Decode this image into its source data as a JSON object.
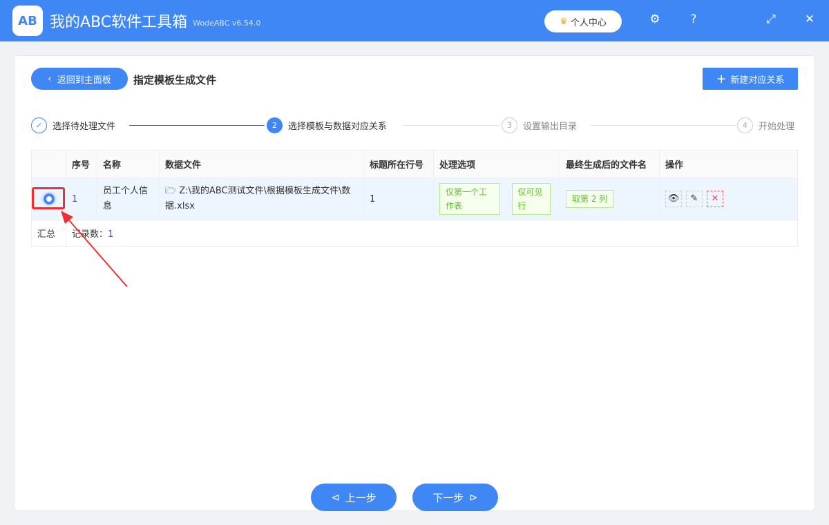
{
  "app": {
    "logo": "AB",
    "title": "我的ABC软件工具箱",
    "version": "WodeABC v6.54.0",
    "user_center": "个人中心"
  },
  "header": {
    "back": "返回到主面板",
    "title": "指定模板生成文件",
    "new_relation": "新建对应关系"
  },
  "steps": [
    {
      "num": "✓",
      "label": "选择待处理文件"
    },
    {
      "num": "2",
      "label": "选择模板与数据对应关系"
    },
    {
      "num": "3",
      "label": "设置输出目录"
    },
    {
      "num": "4",
      "label": "开始处理"
    }
  ],
  "table": {
    "headers": [
      "",
      "序号",
      "名称",
      "数据文件",
      "标题所在行号",
      "处理选项",
      "最终生成后的文件名",
      "操作"
    ],
    "row": {
      "index": "1",
      "name": "员工个人信息",
      "file": "Z:\\我的ABC测试文件\\根据模板生成文件\\数据.xlsx",
      "title_row": "1",
      "options": [
        "仅第一个工作表",
        "仅可见行"
      ],
      "filename": "取第 2 列"
    },
    "summary": {
      "label": "汇总",
      "count_label": "记录数：",
      "count": "1"
    }
  },
  "footer": {
    "prev": "上一步",
    "next": "下一步"
  },
  "colors": {
    "accent": "#3f87f5",
    "highlight": "#f03030"
  }
}
